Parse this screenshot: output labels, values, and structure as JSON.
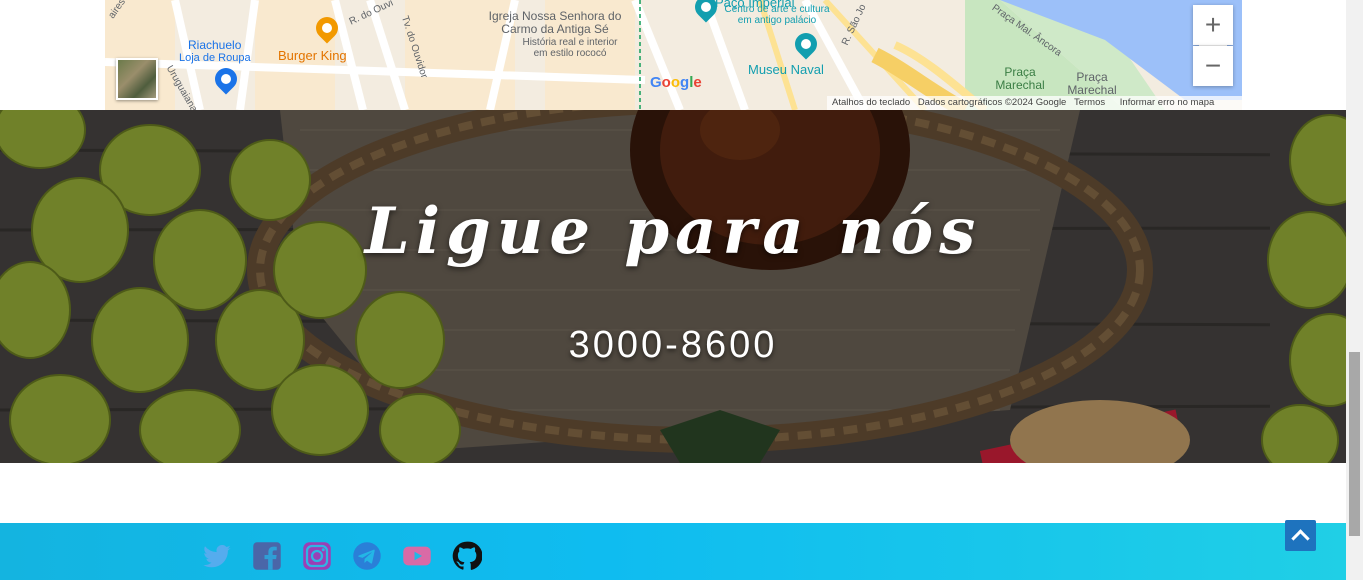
{
  "map": {
    "labels": {
      "riachuelo": "Riachuelo",
      "riachuelo_sub": "Loja de Roupa",
      "burger_king": "Burger King",
      "street_ouvidor": "Tv. do Ouvidor",
      "street_r_ouv": "R. do Ouvi",
      "street_aires": "aires",
      "street_uruguaiana": "Uruguaiana",
      "igreja": "Igreja Nossa Senhora do Carmo da Antiga Sé",
      "igreja_sub": "História real e interior em estilo rococó",
      "paco": "Paço Imperial",
      "paco_sub": "Centro de arte e cultura em antigo palácio",
      "museu": "Museu Naval",
      "street_sao_jose": "R. São Jo",
      "street_praca_ancora": "Praça Mal. Âncora",
      "praca_marechal_1": "Praça Marechal",
      "praca_marechal_2": "Praça Marechal",
      "google": "Google"
    },
    "zoom_in": "+",
    "zoom_out": "−",
    "attribution": {
      "shortcuts": "Atalhos do teclado",
      "data": "Dados cartográficos ©2024 Google",
      "terms": "Termos",
      "report": "Informar erro no mapa"
    }
  },
  "hero": {
    "title": "Ligue para nós",
    "phone": "3000-8600"
  },
  "footer": {
    "social": [
      "twitter-icon",
      "facebook-icon",
      "instagram-icon",
      "telegram-icon",
      "youtube-icon",
      "github-icon"
    ]
  },
  "colors": {
    "footer_gradient_start": "#14b4e0",
    "footer_gradient_end": "#20cfe6",
    "scroll_top": "#1e73be",
    "map_water": "#9cc0f9",
    "map_park": "#c8e6c0"
  }
}
